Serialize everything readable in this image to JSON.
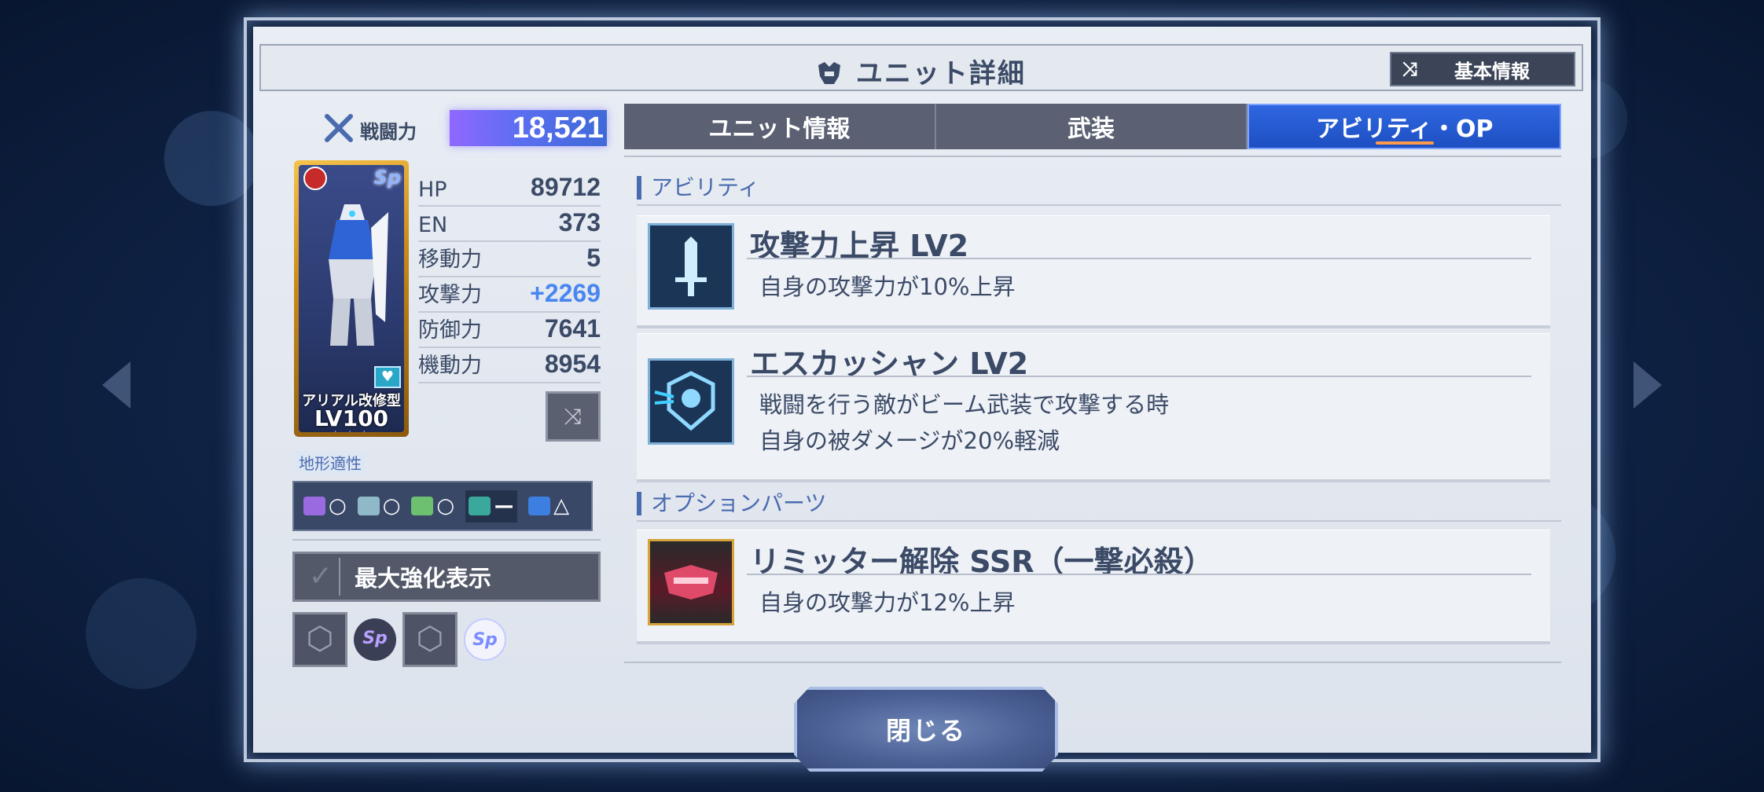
{
  "header": {
    "title": "ユニット詳細",
    "basic_info_button": "基本情報"
  },
  "power": {
    "label": "戦闘力",
    "value": "18,521"
  },
  "card": {
    "name": "アリアル改修型",
    "level": "LV100",
    "stars": "★★★",
    "sp_badge": "Sp"
  },
  "stats": [
    {
      "label": "HP",
      "value": "89712"
    },
    {
      "label": "EN",
      "value": "373"
    },
    {
      "label": "移動力",
      "value": "5"
    },
    {
      "label": "攻撃力",
      "value": "+2269"
    },
    {
      "label": "防御力",
      "value": "7641"
    },
    {
      "label": "機動力",
      "value": "8954"
    }
  ],
  "terrain": {
    "label": "地形適性",
    "items": [
      {
        "icon": "space-terrain-icon",
        "mark": "○"
      },
      {
        "icon": "air-terrain-icon",
        "mark": "○"
      },
      {
        "icon": "ground-terrain-icon",
        "mark": "○"
      },
      {
        "icon": "water-terrain-icon",
        "mark": "ー"
      },
      {
        "icon": "underwater-terrain-icon",
        "mark": "△"
      }
    ]
  },
  "max_enhance": {
    "label": "最大強化表示"
  },
  "slots": {
    "badge1": "Sp",
    "badge2": "Sp"
  },
  "tabs": [
    {
      "label": "ユニット情報"
    },
    {
      "label": "武装"
    },
    {
      "label": "アビリティ・OP"
    }
  ],
  "sections": {
    "ability_heading": "アビリティ",
    "option_heading": "オプションパーツ"
  },
  "abilities": [
    {
      "title": "攻撃力上昇 LV2",
      "desc1": "自身の攻撃力が10%上昇",
      "desc2": ""
    },
    {
      "title": "エスカッシャン LV2",
      "desc1": "戦闘を行う敵がビーム武装で攻撃する時",
      "desc2": "自身の被ダメージが20%軽減"
    }
  ],
  "option_part": {
    "title": "リミッター解除 SSR（一撃必殺）",
    "desc1": "自身の攻撃力が12%上昇"
  },
  "close_button": {
    "label": "閉じる"
  },
  "colors": {
    "accent": "#1d4fc2",
    "panel": "#e4e8ef",
    "text": "#3b4a66",
    "positive": "#4a86f0"
  }
}
